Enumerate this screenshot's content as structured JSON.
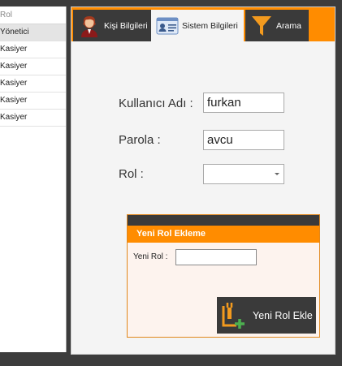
{
  "role_list": {
    "header": "Rol",
    "rows": [
      "Yönetici",
      "Kasiyer",
      "Kasiyer",
      "Kasiyer",
      "Kasiyer",
      "Kasiyer"
    ]
  },
  "tabs": [
    {
      "label": "Kişi Bilgileri",
      "icon": "person-icon"
    },
    {
      "label": "Sistem Bilgileri",
      "icon": "id-card-icon"
    },
    {
      "label": "Arama",
      "icon": "funnel-icon"
    }
  ],
  "form": {
    "username_label": "Kullanıcı Adı :",
    "username_value": "furkan",
    "password_label": "Parola :",
    "password_value": "avcu",
    "role_label": "Rol :",
    "role_value": ""
  },
  "new_role": {
    "title": "Yeni Rol Ekleme",
    "label": "Yeni Rol :",
    "value": "",
    "button_label": "Yeni Rol Ekle"
  },
  "colors": {
    "accent": "#ff8c00",
    "dark": "#3a3a3a"
  }
}
